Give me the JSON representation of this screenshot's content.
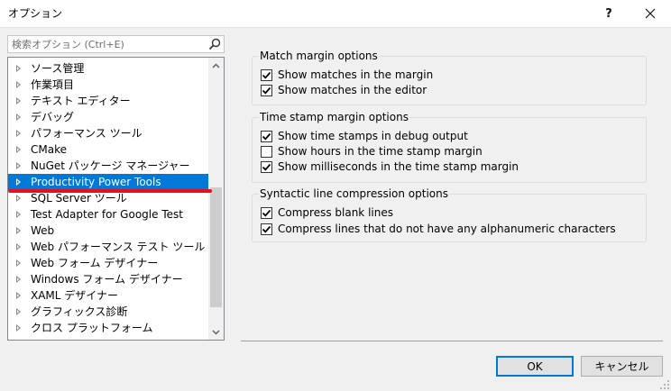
{
  "window": {
    "title": "オプション",
    "help_label": "?",
    "close_icon": "close-icon"
  },
  "search": {
    "placeholder": "検索オプション (Ctrl+E)",
    "icon": "search-icon"
  },
  "tree": {
    "items": [
      {
        "label": "ソース管理"
      },
      {
        "label": "作業項目"
      },
      {
        "label": "テキスト エディター"
      },
      {
        "label": "デバッグ"
      },
      {
        "label": "パフォーマンス ツール"
      },
      {
        "label": "CMake"
      },
      {
        "label": "NuGet パッケージ マネージャー"
      },
      {
        "label": "Productivity Power Tools",
        "selected": true
      },
      {
        "label": "SQL Server ツール"
      },
      {
        "label": "Test Adapter for Google Test"
      },
      {
        "label": "Web"
      },
      {
        "label": "Web パフォーマンス テスト ツール"
      },
      {
        "label": "Web フォーム デザイナー"
      },
      {
        "label": "Windows フォーム デザイナー"
      },
      {
        "label": "XAML デザイナー"
      },
      {
        "label": "グラフィックス診断"
      },
      {
        "label": "クロス プラットフォーム"
      }
    ],
    "selected_highlight_color": "#0078d7",
    "annotation_underline_color": "#e8101c"
  },
  "groups": [
    {
      "title": "Match margin options",
      "options": [
        {
          "label": "Show matches in the margin",
          "checked": true
        },
        {
          "label": "Show matches in the editor",
          "checked": true
        }
      ]
    },
    {
      "title": "Time stamp margin options",
      "options": [
        {
          "label": "Show time stamps in debug output",
          "checked": true
        },
        {
          "label": "Show hours in the time stamp margin",
          "checked": false
        },
        {
          "label": "Show milliseconds in the time stamp margin",
          "checked": true
        }
      ]
    },
    {
      "title": "Syntactic line compression options",
      "options": [
        {
          "label": "Compress blank lines",
          "checked": true
        },
        {
          "label": "Compress lines that do not have any alphanumeric characters",
          "checked": true
        }
      ]
    }
  ],
  "buttons": {
    "ok_label": "OK",
    "cancel_label": "キャンセル"
  }
}
